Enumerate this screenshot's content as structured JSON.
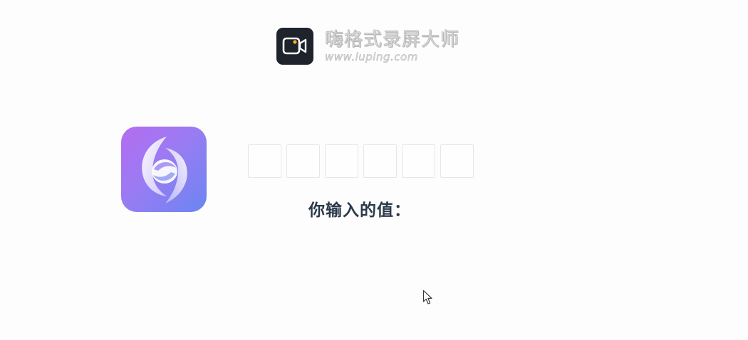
{
  "watermark": {
    "title": "嗨格式录屏大师",
    "url": "www.luping.com",
    "icon": "video-camera-icon"
  },
  "app_logo": {
    "icon": "swirl-logo-icon",
    "gradient_start": "#b46cf0",
    "gradient_end": "#6b86f2"
  },
  "code_inputs": {
    "count": 6,
    "values": [
      "",
      "",
      "",
      "",
      "",
      ""
    ]
  },
  "result": {
    "label": "你输入的值："
  },
  "cursor": {
    "icon": "mouse-pointer-icon"
  }
}
